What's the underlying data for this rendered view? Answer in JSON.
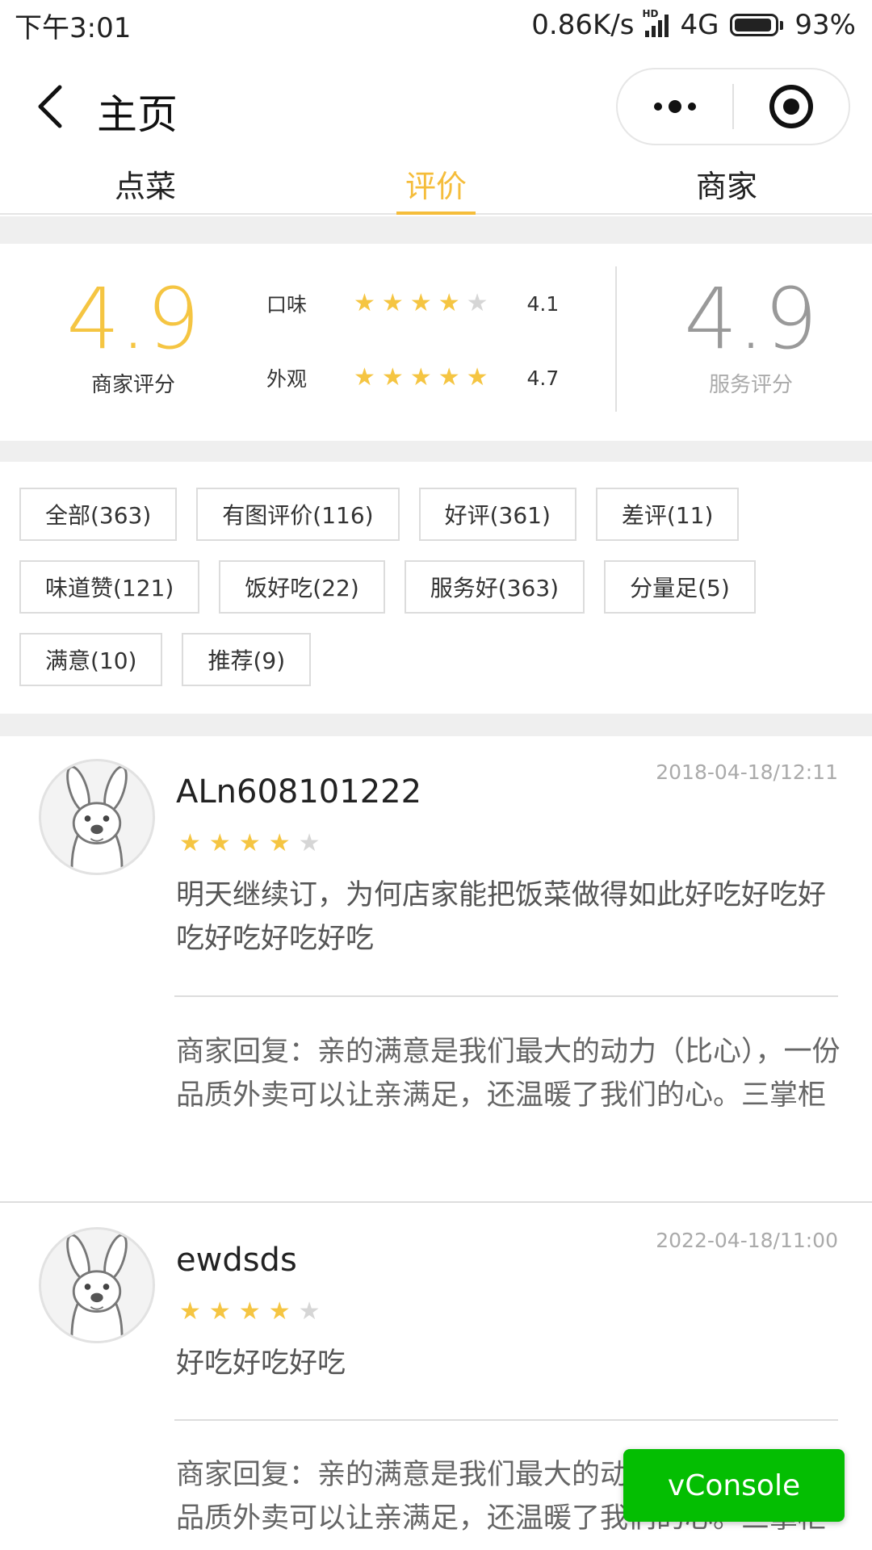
{
  "status_bar": {
    "time": "下午3:01",
    "network_speed": "0.86K/s",
    "signal_label": "HD",
    "network_type": "4G",
    "battery": "93%"
  },
  "nav": {
    "title": "主页"
  },
  "tabs": [
    {
      "label": "点菜",
      "active": false
    },
    {
      "label": "评价",
      "active": true
    },
    {
      "label": "商家",
      "active": false
    }
  ],
  "scores": {
    "merchant": {
      "value": "4.9",
      "label": "商家评分",
      "color": "#f5c542"
    },
    "service": {
      "value": "4.9",
      "label": "服务评分",
      "color": "#999999"
    },
    "details": [
      {
        "name": "口味",
        "stars": 4,
        "value": "4.1"
      },
      {
        "name": "外观",
        "stars": 5,
        "value": "4.7"
      }
    ]
  },
  "filters": [
    [
      "全部(363)",
      "有图评价(116)",
      "好评(361)",
      "差评(11)"
    ],
    [
      "味道赞(121)",
      "饭好吃(22)",
      "服务好(363)",
      "分量足(5)"
    ],
    [
      "满意(10)",
      "推荐(9)"
    ]
  ],
  "reviews": [
    {
      "user": "ALn608101222",
      "date": "2018-04-18/12:11",
      "stars": 4,
      "text": "明天继续订，为何店家能把饭菜做得如此好吃好吃好吃好吃好吃好吃",
      "reply": "商家回复：亲的满意是我们最大的动力（比心），一份品质外卖可以让亲满足，还温暖了我们的心。三掌柜"
    },
    {
      "user": "ewdsds",
      "date": "2022-04-18/11:00",
      "stars": 4,
      "text": "好吃好吃好吃",
      "reply": "商家回复：亲的满意是我们最大的动力（比心），一份品质外卖可以让亲满足，还温暖了我们的心。三掌柜"
    }
  ],
  "colors": {
    "accent": "#f5bd3b",
    "star_on": "#f5c542",
    "star_off": "#d6d6d6",
    "vconsole": "#04be02"
  },
  "vconsole_label": "vConsole"
}
